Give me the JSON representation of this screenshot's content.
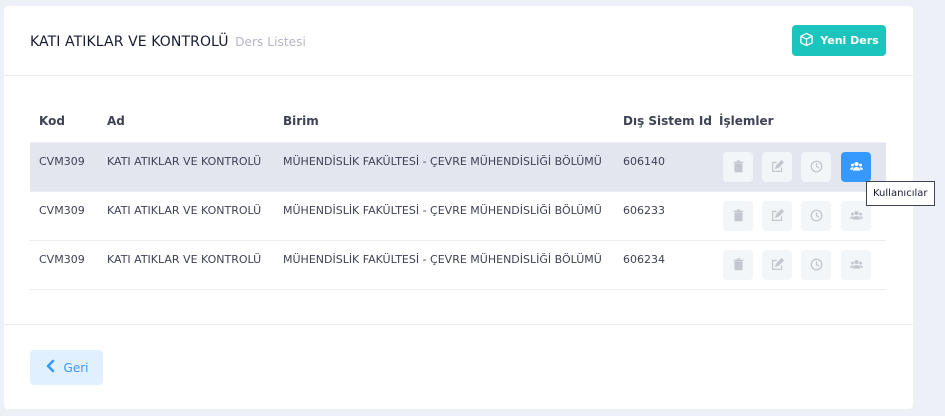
{
  "header": {
    "title": "KATI ATIKLAR VE KONTROLÜ",
    "subtitle": "Ders Listesi",
    "new_button_label": "Yeni Ders"
  },
  "table": {
    "columns": [
      "Kod",
      "Ad",
      "Birim",
      "Dış Sistem Id",
      "İşlemler"
    ],
    "rows": [
      {
        "kod": "CVM309",
        "ad": "KATI ATIKLAR VE KONTROLÜ",
        "birim": "MÜHENDİSLİK FAKÜLTESİ - ÇEVRE MÜHENDİSLİĞİ BÖLÜMÜ",
        "dis_sistem_id": "606140"
      },
      {
        "kod": "CVM309",
        "ad": "KATI ATIKLAR VE KONTROLÜ",
        "birim": "MÜHENDİSLİK FAKÜLTESİ - ÇEVRE MÜHENDİSLİĞİ BÖLÜMÜ",
        "dis_sistem_id": "606233"
      },
      {
        "kod": "CVM309",
        "ad": "KATI ATIKLAR VE KONTROLÜ",
        "birim": "MÜHENDİSLİK FAKÜLTESİ - ÇEVRE MÜHENDİSLİĞİ BÖLÜMÜ",
        "dis_sistem_id": "606234"
      }
    ],
    "actions": [
      "trash-icon",
      "edit-icon",
      "clock-icon",
      "users-icon"
    ]
  },
  "tooltip": {
    "text": "Kullanıcılar"
  },
  "footer": {
    "back_label": "Geri"
  },
  "colors": {
    "accent_teal": "#1bc5bd",
    "primary_blue": "#3699ff",
    "light_blue": "#e1f0ff",
    "row_highlight": "#e4e6ef"
  }
}
